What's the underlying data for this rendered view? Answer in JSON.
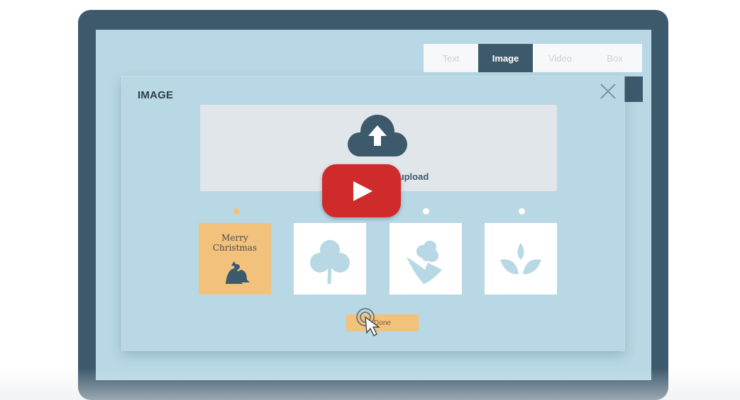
{
  "tabs": [
    {
      "label": "Text",
      "active": false
    },
    {
      "label": "Image",
      "active": true
    },
    {
      "label": "Video",
      "active": false
    },
    {
      "label": "Box",
      "active": false
    }
  ],
  "modal": {
    "title": "IMAGE",
    "close_icon": "close-icon",
    "dropzone": {
      "icon": "cloud-upload-icon",
      "text": "Drop or click to upload"
    },
    "thumbnails": [
      {
        "name": "merry-christmas-card",
        "caption_line1": "Merry",
        "caption_line2": "Christmas",
        "icon": "bells-icon",
        "selected": true
      },
      {
        "name": "clover",
        "icon": "clover-icon",
        "selected": false
      },
      {
        "name": "flower",
        "icon": "flower-icon",
        "selected": false
      },
      {
        "name": "leaves",
        "icon": "leaves-icon",
        "selected": false
      }
    ],
    "done_label": "Done"
  },
  "video_overlay": {
    "icon": "play-icon"
  },
  "colors": {
    "frame": "#3d5a6c",
    "screen": "#b7d8e4",
    "dropzone": "#e1e6ea",
    "accent": "#f2c27d",
    "play_button": "#cf2b2b"
  }
}
